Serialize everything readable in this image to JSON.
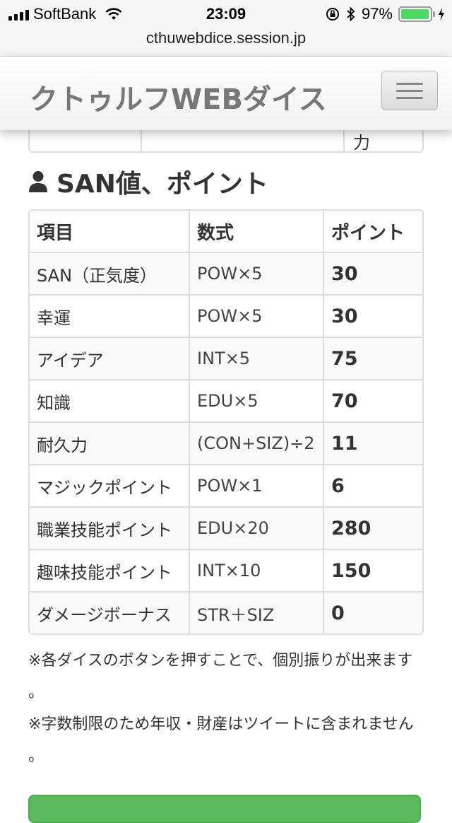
{
  "status_bar": {
    "carrier": "SoftBank",
    "time": "23:09",
    "battery": "97%",
    "battery_level": 0.97
  },
  "browser": {
    "url": "cthuwebdice.session.jp"
  },
  "navbar": {
    "brand": "クトゥルフWEBダイス"
  },
  "previous_table": {
    "fragment": "力"
  },
  "section": {
    "heading": "SAN値、ポイント",
    "table": {
      "headers": [
        "項目",
        "数式",
        "ポイント"
      ],
      "rows": [
        {
          "item": "SAN（正気度）",
          "formula": "POW×5",
          "point": "30"
        },
        {
          "item": "幸運",
          "formula": "POW×5",
          "point": "30"
        },
        {
          "item": "アイデア",
          "formula": "INT×5",
          "point": "75"
        },
        {
          "item": "知識",
          "formula": "EDU×5",
          "point": "70"
        },
        {
          "item": "耐久力",
          "formula": "(CON+SIZ)÷2",
          "point": "11"
        },
        {
          "item": "マジックポイント",
          "formula": "POW×1",
          "point": "6"
        },
        {
          "item": "職業技能ポイント",
          "formula": "EDU×20",
          "point": "280"
        },
        {
          "item": "趣味技能ポイント",
          "formula": "INT×10",
          "point": "150"
        },
        {
          "item": "ダメージボーナス",
          "formula": "STR＋SIZ",
          "point": "0"
        }
      ]
    }
  },
  "notes": {
    "line1": "※各ダイスのボタンを押すことで、個別振りが出来ます",
    "line1_end": "。",
    "line2": "※字数制限のため年収・財産はツイートに含まれません",
    "line2_end": "。"
  },
  "colors": {
    "brand_text": "#777777",
    "button_green": "#5cb85c",
    "battery_green": "#4cd964",
    "table_border": "#dddddd"
  }
}
